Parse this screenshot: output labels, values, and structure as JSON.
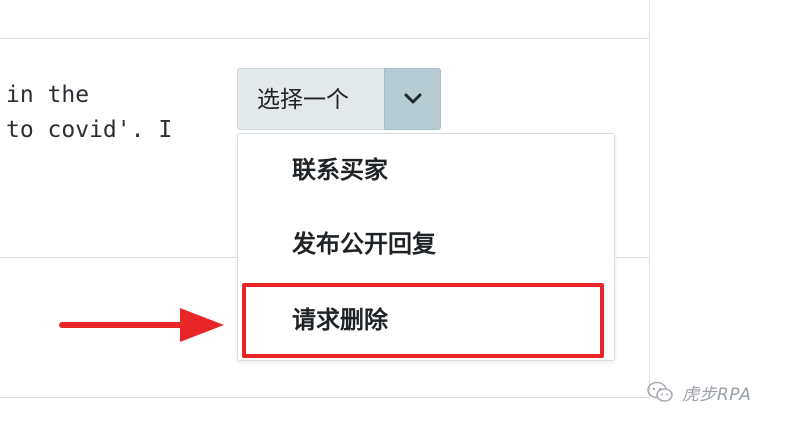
{
  "review": {
    "line1": "in the",
    "line2": "to covid'. I"
  },
  "select": {
    "label": "选择一个",
    "caret_icon": "chevron-down-icon"
  },
  "dropdown": {
    "items": [
      {
        "label": "联系买家"
      },
      {
        "label": "发布公开回复"
      },
      {
        "label": "请求删除"
      }
    ],
    "highlighted_index": 2
  },
  "annotation": {
    "arrow_color": "#e8262a",
    "highlight_color": "#e8262a"
  },
  "watermark": {
    "icon": "wechat-icon",
    "text": "虎步RPA"
  }
}
